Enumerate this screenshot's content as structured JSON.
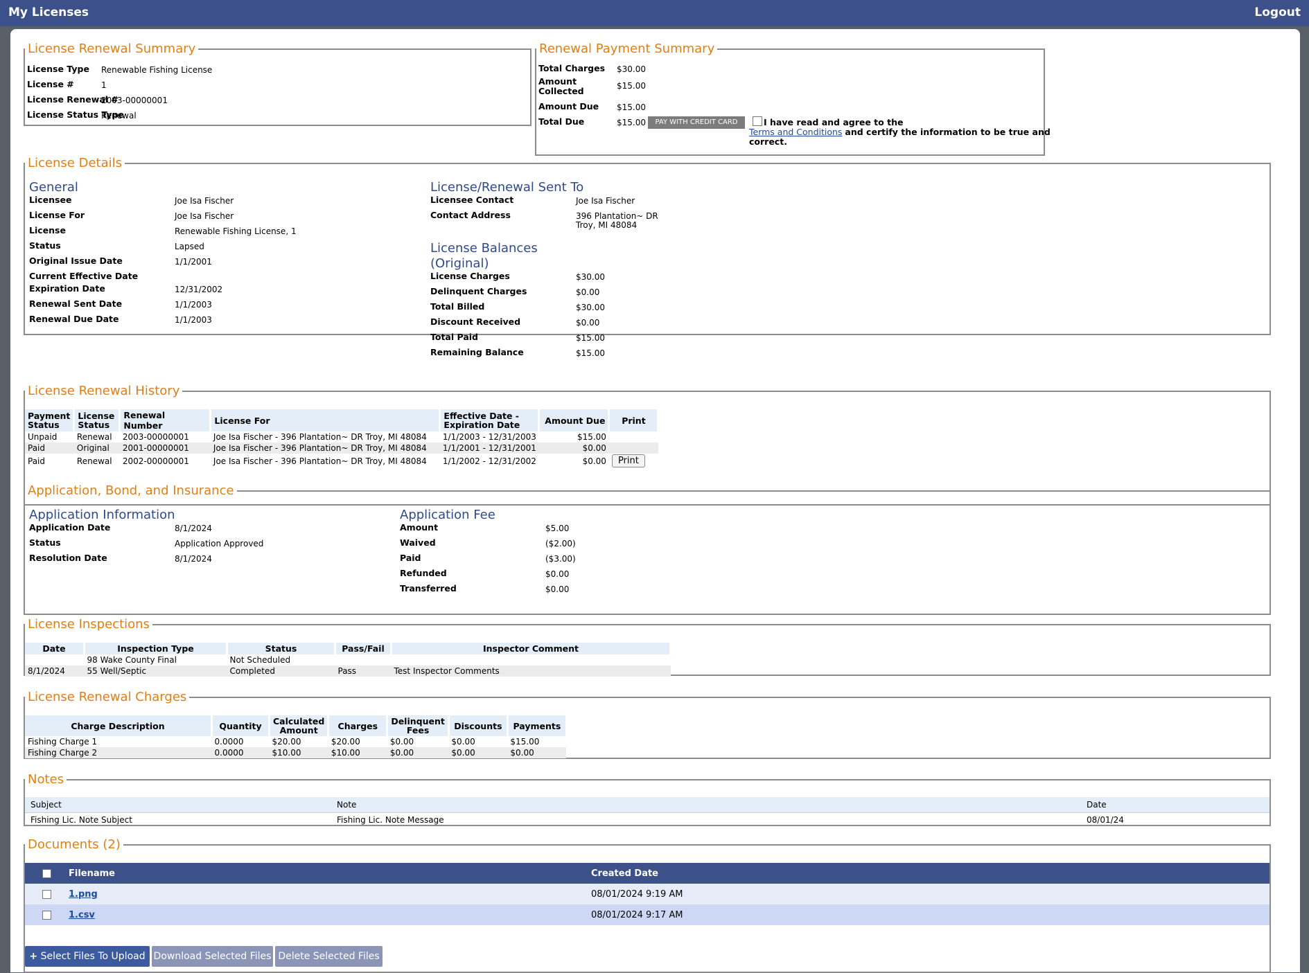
{
  "header": {
    "title": "My Licenses",
    "logout": "Logout"
  },
  "renewal_summary": {
    "legend": "License Renewal Summary",
    "rows": [
      {
        "label": "License Type",
        "value": "Renewable Fishing License"
      },
      {
        "label": "License #",
        "value": "1"
      },
      {
        "label": "License Renewal #",
        "value": "2003-00000001"
      },
      {
        "label": "License Status Type",
        "value": "Renewal"
      }
    ]
  },
  "payment_summary": {
    "legend": "Renewal Payment Summary",
    "total_charges_label": "Total Charges",
    "total_charges": "$30.00",
    "amount_collected_label": "Amount Collected",
    "amount_collected": "$15.00",
    "amount_due_label": "Amount Due",
    "amount_due": "$15.00",
    "total_due_label": "Total Due",
    "total_due": "$15.00",
    "pay_button": "PAY WITH CREDIT CARD",
    "agree_text_1": "I have read and agree to the",
    "terms_link": "Terms and Conditions",
    "agree_text_2": "and certify the information to be true and",
    "agree_text_3": "correct."
  },
  "details": {
    "legend": "License Details",
    "general_title": "General",
    "general": [
      {
        "label": "Licensee",
        "value": "Joe Isa Fischer"
      },
      {
        "label": "License For",
        "value": "Joe Isa Fischer"
      },
      {
        "label": "License",
        "value": "Renewable Fishing License, 1"
      },
      {
        "label": "Status",
        "value": "Lapsed"
      },
      {
        "label": "Original Issue Date",
        "value": "1/1/2001"
      },
      {
        "label": "Current Effective Date",
        "value": ""
      },
      {
        "label": "Expiration Date",
        "value": "12/31/2002"
      },
      {
        "label": "Renewal Sent Date",
        "value": "1/1/2003"
      },
      {
        "label": "Renewal Due Date",
        "value": "1/1/2003"
      }
    ],
    "sent_to_title": "License/Renewal Sent To",
    "contact_label": "Licensee Contact",
    "contact": "Joe Isa Fischer",
    "address_label": "Contact Address",
    "address_1": "396 Plantation~ DR",
    "address_2": "Troy, MI 48084",
    "balances_title_1": "License Balances",
    "balances_title_2": "(Original)",
    "balances": [
      {
        "label": "License Charges",
        "value": "$30.00"
      },
      {
        "label": "Delinquent Charges",
        "value": "$0.00"
      },
      {
        "label": "Total Billed",
        "value": "$30.00"
      },
      {
        "label": "Discount Received",
        "value": "$0.00"
      },
      {
        "label": "Total Paid",
        "value": "$15.00"
      },
      {
        "label": "Remaining Balance",
        "value": "$15.00"
      }
    ]
  },
  "history": {
    "legend": "License Renewal History",
    "headers": {
      "payment_status": "Payment Status",
      "license_status": "License Status",
      "renewal_number": "Renewal Number",
      "license_for": "License For",
      "dates": "Effective Date - Expiration Date",
      "amount_due": "Amount Due",
      "print": "Print"
    },
    "rows": [
      {
        "payment_status": "Unpaid",
        "license_status": "Renewal",
        "renewal_number": "2003-00000001",
        "license_for": "Joe Isa Fischer - 396 Plantation~ DR Troy, MI 48084",
        "dates": "1/1/2003 - 12/31/2003",
        "amount": "$15.00",
        "print": ""
      },
      {
        "payment_status": "Paid",
        "license_status": "Original",
        "renewal_number": "2001-00000001",
        "license_for": "Joe Isa Fischer - 396 Plantation~ DR Troy, MI 48084",
        "dates": "1/1/2001 - 12/31/2001",
        "amount": "$0.00",
        "print": ""
      },
      {
        "payment_status": "Paid",
        "license_status": "Renewal",
        "renewal_number": "2002-00000001",
        "license_for": "Joe Isa Fischer - 396 Plantation~ DR Troy, MI 48084",
        "dates": "1/1/2002 - 12/31/2002",
        "amount": "$0.00",
        "print": "Print"
      }
    ]
  },
  "application": {
    "legend": "Application, Bond, and Insurance",
    "info_title": "Application Information",
    "info": [
      {
        "label": "Application Date",
        "value": "8/1/2024"
      },
      {
        "label": "Status",
        "value": "Application Approved"
      },
      {
        "label": "Resolution Date",
        "value": "8/1/2024"
      }
    ],
    "fee_title": "Application Fee",
    "fee": [
      {
        "label": "Amount",
        "value": "$5.00"
      },
      {
        "label": "Waived",
        "value": "($2.00)"
      },
      {
        "label": "Paid",
        "value": "($3.00)"
      },
      {
        "label": "Refunded",
        "value": "$0.00"
      },
      {
        "label": "Transferred",
        "value": "$0.00"
      }
    ]
  },
  "inspections": {
    "legend": "License Inspections",
    "headers": {
      "date": "Date",
      "type": "Inspection Type",
      "status": "Status",
      "pass_fail": "Pass/Fail",
      "comment": "Inspector Comment"
    },
    "rows": [
      {
        "date": "",
        "type": "98 Wake County Final",
        "status": "Not Scheduled",
        "pass_fail": "",
        "comment": ""
      },
      {
        "date": "8/1/2024",
        "type": "55 Well/Septic",
        "status": "Completed",
        "pass_fail": "Pass",
        "comment": "Test Inspector Comments"
      }
    ]
  },
  "charges": {
    "legend": "License Renewal Charges",
    "headers": {
      "description": "Charge Description",
      "quantity": "Quantity",
      "calculated": "Calculated Amount",
      "charges": "Charges",
      "delinquent": "Delinquent Fees",
      "discounts": "Discounts",
      "payments": "Payments"
    },
    "rows": [
      {
        "description": "Fishing Charge 1",
        "quantity": "0.0000",
        "calculated": "$20.00",
        "charges": "$20.00",
        "delinquent": "$0.00",
        "discounts": "$0.00",
        "payments": "$15.00"
      },
      {
        "description": "Fishing Charge 2",
        "quantity": "0.0000",
        "calculated": "$10.00",
        "charges": "$10.00",
        "delinquent": "$0.00",
        "discounts": "$0.00",
        "payments": "$0.00"
      }
    ]
  },
  "notes": {
    "legend": "Notes",
    "headers": {
      "subject": "Subject",
      "note": "Note",
      "date": "Date"
    },
    "rows": [
      {
        "subject": "Fishing Lic. Note Subject",
        "note": "Fishing Lic. Note Message",
        "date": "08/01/24"
      }
    ]
  },
  "documents": {
    "legend": "Documents (2)",
    "headers": {
      "filename": "Filename",
      "created": "Created Date"
    },
    "rows": [
      {
        "filename": "1.png",
        "created": "08/01/2024 9:19 AM"
      },
      {
        "filename": "1.csv",
        "created": "08/01/2024 9:17 AM"
      }
    ],
    "upload_button": "Select Files To Upload",
    "download_button": "Download Selected Files",
    "delete_button": "Delete Selected Files"
  }
}
